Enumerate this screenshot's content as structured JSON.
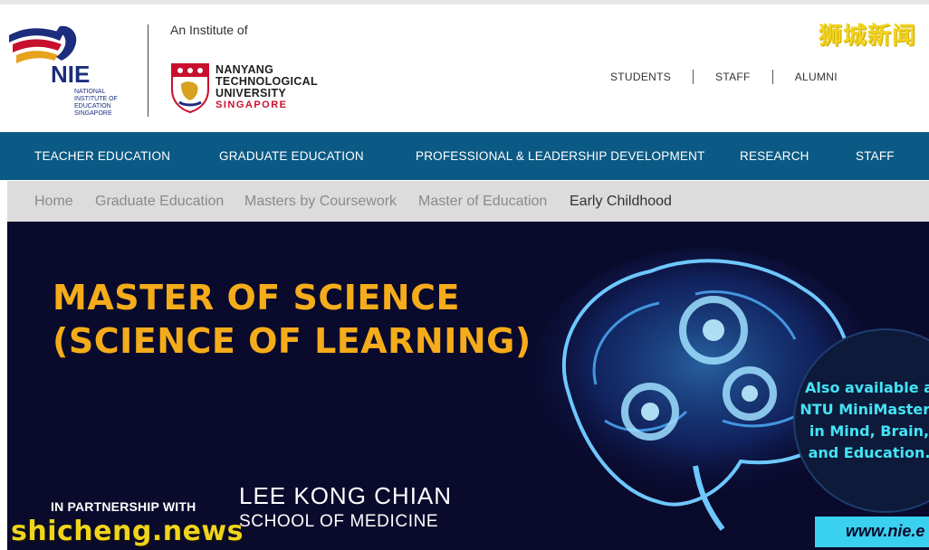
{
  "header": {
    "nie_logo": {
      "abbr": "NIE",
      "full_lines": [
        "NATIONAL",
        "INSTITUTE OF",
        "EDUCATION",
        "SINGAPORE"
      ]
    },
    "institute_of": "An Institute of",
    "ntu": {
      "line1": "NANYANG",
      "line2": "TECHNOLOGICAL",
      "line3": "UNIVERSITY",
      "line4": "SINGAPORE"
    },
    "top_links": [
      "STUDENTS",
      "STAFF",
      "ALUMNI"
    ],
    "watermark": "狮城新闻"
  },
  "main_nav": [
    "TEACHER EDUCATION",
    "GRADUATE EDUCATION",
    "PROFESSIONAL & LEADERSHIP DEVELOPMENT",
    "RESEARCH",
    "STAFF"
  ],
  "breadcrumb": [
    "Home",
    "Graduate Education",
    "Masters by Coursework",
    "Master of Education",
    "Early Childhood"
  ],
  "hero": {
    "title_line1": "MASTER OF SCIENCE",
    "title_line2": "(SCIENCE OF LEARNING)",
    "partnership": "IN PARTNERSHIP WITH",
    "partner_line1": "LEE KONG CHIAN",
    "partner_line2": "SCHOOL OF MEDICINE",
    "badge_lines": [
      "Also available a",
      "NTU MiniMasters",
      "in Mind, Brain,",
      "and Education."
    ],
    "url": "www.nie.e",
    "watermark": "shicheng.news"
  },
  "colors": {
    "nav_bg": "#0b5a85",
    "hero_bg": "#0a0a2c",
    "title": "#f5ac1a",
    "badge_text": "#44e3f5",
    "ntu_red": "#c8102e"
  }
}
